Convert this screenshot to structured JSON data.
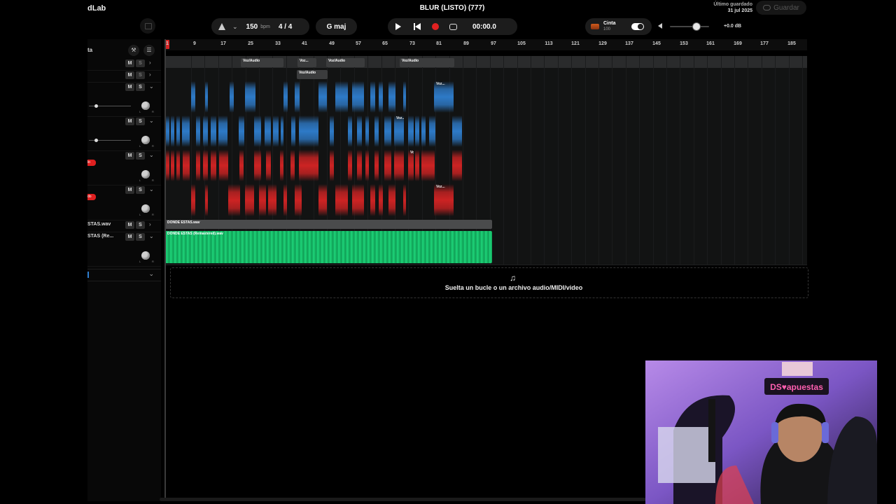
{
  "app": {
    "brand": "dLab",
    "project_title": "BLUR (LISTO) (777)"
  },
  "topbar": {
    "tempo_value": "150",
    "tempo_unit": "bpm",
    "time_signature": "4 / 4",
    "key": "G maj",
    "time_display": "00:00.0",
    "tape": {
      "label": "Cinta",
      "value": "100"
    },
    "master_volume": "+0.0 dB",
    "last_saved_label": "Último guardado",
    "last_saved_date": "31 jul 2025",
    "save_button": "Guardar"
  },
  "left_panel": {
    "header_partial": "ta",
    "tracks": [
      {
        "name": "",
        "mute": "M",
        "solo": "S"
      },
      {
        "name": "",
        "mute": "M",
        "solo": "S"
      },
      {
        "name": "",
        "mute": "M",
        "solo": "S"
      },
      {
        "name": "",
        "mute": "M",
        "solo": "S"
      },
      {
        "name": "",
        "mute": "M",
        "solo": "S",
        "tag": "lo"
      },
      {
        "name": "",
        "mute": "M",
        "solo": "S",
        "tag": "do"
      },
      {
        "name": "STAS.wav",
        "mute": "M",
        "solo": "S"
      },
      {
        "name": "STAS (Re...",
        "mute": "M",
        "solo": "S"
      }
    ],
    "knob_left": "L",
    "knob_right": "R"
  },
  "ruler": {
    "ticks": [
      "1",
      "9",
      "17",
      "25",
      "33",
      "41",
      "49",
      "57",
      "65",
      "73",
      "81",
      "89",
      "97",
      "105",
      "113",
      "121",
      "129",
      "137",
      "145",
      "153",
      "161",
      "169",
      "177",
      "185"
    ]
  },
  "clips": {
    "voz_audio": "Voz/Audio",
    "voz_short": "Voz...",
    "track7_clip": "DONDE ESTAS.wav",
    "track8_clip": "DONDE ESTAS (Remastered).wav"
  },
  "drop_zone": {
    "text": "Suelta un bucle o un archivo audio/MIDI/video"
  },
  "colors": {
    "blue": "#2f7fd0",
    "red": "#d62424",
    "green": "#18c06a",
    "gray_clip": "#3b3c3d",
    "record": "#e12121"
  },
  "icons": [
    "metronome-icon",
    "chevron-down-icon",
    "play-icon",
    "skip-back-icon",
    "record-icon",
    "loop-icon",
    "tape-icon",
    "speaker-icon",
    "cloud-icon",
    "music-note-icon",
    "wrench-icon",
    "settings-icon"
  ]
}
